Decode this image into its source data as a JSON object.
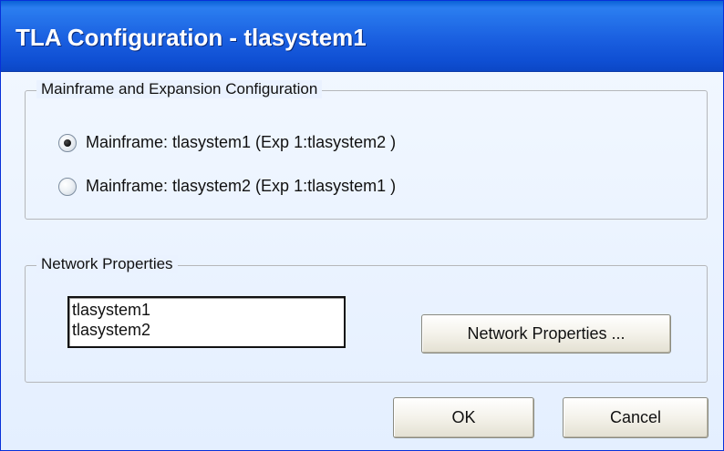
{
  "window": {
    "title": "TLA Configuration - tlasystem1"
  },
  "mainframe_group": {
    "label": "Mainframe and Expansion Configuration",
    "options": [
      {
        "label": "Mainframe: tlasystem1 (Exp 1:tlasystem2 )",
        "selected": true
      },
      {
        "label": "Mainframe: tlasystem2 (Exp 1:tlasystem1 )",
        "selected": false
      }
    ]
  },
  "network_group": {
    "label": "Network Properties",
    "systems": [
      "tlasystem1",
      "tlasystem2"
    ],
    "properties_button": "Network Properties ..."
  },
  "buttons": {
    "ok": "OK",
    "cancel": "Cancel"
  }
}
